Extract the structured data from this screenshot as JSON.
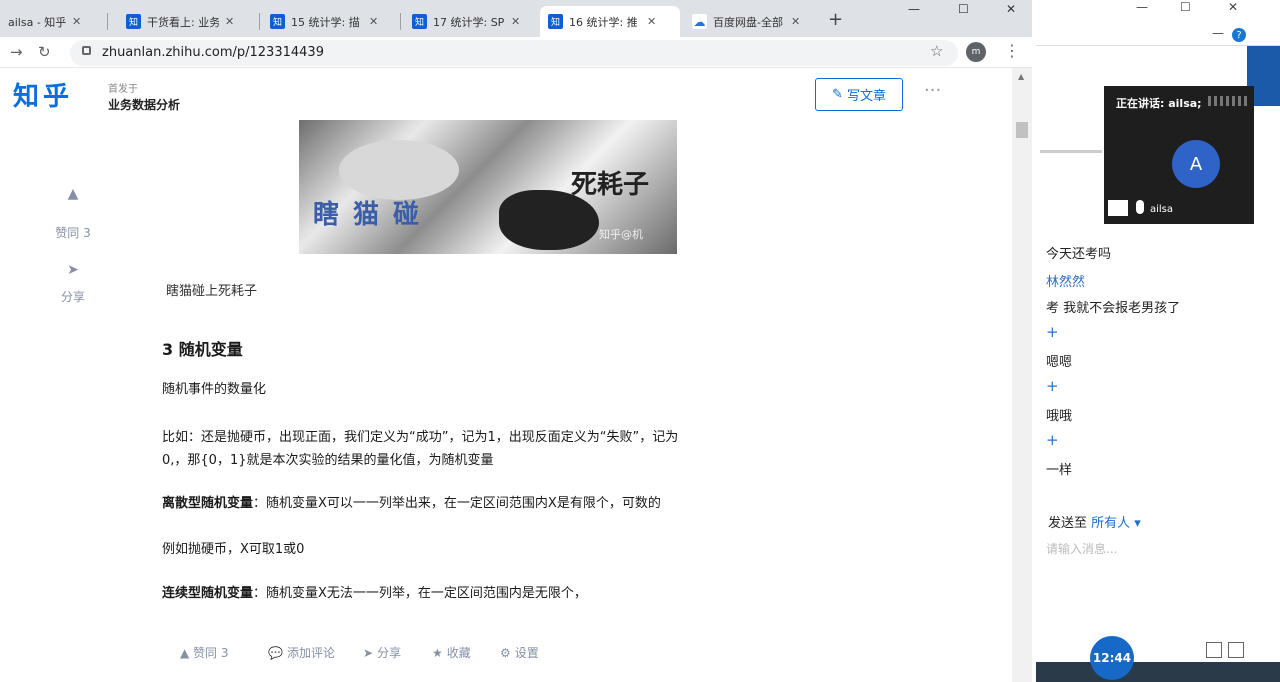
{
  "tabs": [
    {
      "label": "ailsa - 知乎",
      "favicon": ""
    },
    {
      "label": "干货看上: 业务",
      "favicon": "知"
    },
    {
      "label": "15 统计学: 描",
      "favicon": "知"
    },
    {
      "label": "17 统计学: SP",
      "favicon": "知"
    },
    {
      "label": "16 统计学: 推",
      "favicon": "知"
    },
    {
      "label": "百度网盘-全部",
      "favicon": "☁"
    }
  ],
  "new_tab": "+",
  "address": {
    "url": "zhuanlan.zhihu.com/p/123314439",
    "profile": "m"
  },
  "header": {
    "logo": "知乎",
    "published_label": "首发于",
    "column_name": "业务数据分析",
    "write_button": "写文章",
    "more": "···"
  },
  "sidebar": {
    "upvote_label": "赞同 3",
    "share_label": "分享"
  },
  "hero_image": {
    "text_top": "死耗子",
    "text_left": "瞎猫碰",
    "watermark": "知乎@机"
  },
  "article": {
    "caption": "瞎猫碰上死耗子",
    "heading": "3 随机变量",
    "p1": "随机事件的数量化",
    "p2_line1": "比如：还是抛硬币，出现正面，我们定义为“成功”，记为1，出现反面定义为“失败”，记为",
    "p2_line2": "0,，那{0，1}就是本次实验的结果的量化值，为随机变量",
    "p3_bold": "离散型随机变量",
    "p3_rest": "：随机变量X可以一一列举出来，在一定区间范围内X是有限个，可数的",
    "p4": "例如抛硬币，X可取1或0",
    "p5_bold": "连续型随机变量",
    "p5_rest": "：随机变量X无法一一列举，在一定区间范围内是无限个，"
  },
  "bottom_actions": {
    "upvote": "▲ 赞同 3",
    "comment": "添加评论",
    "share": "分享",
    "collect": "收藏",
    "settings": "设置"
  },
  "meeting": {
    "speaking_label": "正在讲话: ailsa;",
    "avatar_letter": "A",
    "username": "ailsa"
  },
  "chat": {
    "lines": [
      {
        "type": "text",
        "text": "今天还考吗"
      },
      {
        "type": "name",
        "text": "林然然"
      },
      {
        "type": "text",
        "text": "考 我就不会报老男孩了"
      },
      {
        "type": "plus",
        "text": "+"
      },
      {
        "type": "text",
        "text": "嗯嗯"
      },
      {
        "type": "plus",
        "text": "+"
      },
      {
        "type": "text",
        "text": "哦哦"
      },
      {
        "type": "plus",
        "text": "+"
      },
      {
        "type": "text",
        "text": "一样"
      }
    ],
    "send_to_label": "发送至",
    "send_to_target": "所有人 ▾",
    "input_placeholder": "请输入消息..."
  },
  "clock": "12:44",
  "colors": {
    "zhihu_blue": "#0a6de0",
    "chat_blue": "#2b6fcf"
  }
}
